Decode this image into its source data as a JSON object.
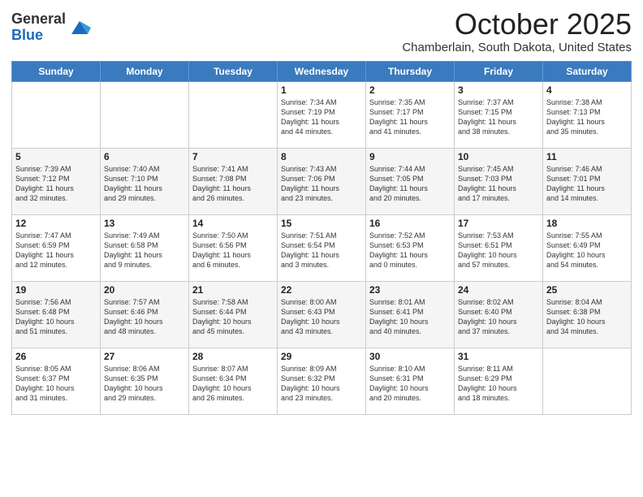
{
  "header": {
    "logo_general": "General",
    "logo_blue": "Blue",
    "month": "October 2025",
    "location": "Chamberlain, South Dakota, United States"
  },
  "weekdays": [
    "Sunday",
    "Monday",
    "Tuesday",
    "Wednesday",
    "Thursday",
    "Friday",
    "Saturday"
  ],
  "weeks": [
    [
      {
        "day": "",
        "info": ""
      },
      {
        "day": "",
        "info": ""
      },
      {
        "day": "",
        "info": ""
      },
      {
        "day": "1",
        "info": "Sunrise: 7:34 AM\nSunset: 7:19 PM\nDaylight: 11 hours\nand 44 minutes."
      },
      {
        "day": "2",
        "info": "Sunrise: 7:35 AM\nSunset: 7:17 PM\nDaylight: 11 hours\nand 41 minutes."
      },
      {
        "day": "3",
        "info": "Sunrise: 7:37 AM\nSunset: 7:15 PM\nDaylight: 11 hours\nand 38 minutes."
      },
      {
        "day": "4",
        "info": "Sunrise: 7:38 AM\nSunset: 7:13 PM\nDaylight: 11 hours\nand 35 minutes."
      }
    ],
    [
      {
        "day": "5",
        "info": "Sunrise: 7:39 AM\nSunset: 7:12 PM\nDaylight: 11 hours\nand 32 minutes."
      },
      {
        "day": "6",
        "info": "Sunrise: 7:40 AM\nSunset: 7:10 PM\nDaylight: 11 hours\nand 29 minutes."
      },
      {
        "day": "7",
        "info": "Sunrise: 7:41 AM\nSunset: 7:08 PM\nDaylight: 11 hours\nand 26 minutes."
      },
      {
        "day": "8",
        "info": "Sunrise: 7:43 AM\nSunset: 7:06 PM\nDaylight: 11 hours\nand 23 minutes."
      },
      {
        "day": "9",
        "info": "Sunrise: 7:44 AM\nSunset: 7:05 PM\nDaylight: 11 hours\nand 20 minutes."
      },
      {
        "day": "10",
        "info": "Sunrise: 7:45 AM\nSunset: 7:03 PM\nDaylight: 11 hours\nand 17 minutes."
      },
      {
        "day": "11",
        "info": "Sunrise: 7:46 AM\nSunset: 7:01 PM\nDaylight: 11 hours\nand 14 minutes."
      }
    ],
    [
      {
        "day": "12",
        "info": "Sunrise: 7:47 AM\nSunset: 6:59 PM\nDaylight: 11 hours\nand 12 minutes."
      },
      {
        "day": "13",
        "info": "Sunrise: 7:49 AM\nSunset: 6:58 PM\nDaylight: 11 hours\nand 9 minutes."
      },
      {
        "day": "14",
        "info": "Sunrise: 7:50 AM\nSunset: 6:56 PM\nDaylight: 11 hours\nand 6 minutes."
      },
      {
        "day": "15",
        "info": "Sunrise: 7:51 AM\nSunset: 6:54 PM\nDaylight: 11 hours\nand 3 minutes."
      },
      {
        "day": "16",
        "info": "Sunrise: 7:52 AM\nSunset: 6:53 PM\nDaylight: 11 hours\nand 0 minutes."
      },
      {
        "day": "17",
        "info": "Sunrise: 7:53 AM\nSunset: 6:51 PM\nDaylight: 10 hours\nand 57 minutes."
      },
      {
        "day": "18",
        "info": "Sunrise: 7:55 AM\nSunset: 6:49 PM\nDaylight: 10 hours\nand 54 minutes."
      }
    ],
    [
      {
        "day": "19",
        "info": "Sunrise: 7:56 AM\nSunset: 6:48 PM\nDaylight: 10 hours\nand 51 minutes."
      },
      {
        "day": "20",
        "info": "Sunrise: 7:57 AM\nSunset: 6:46 PM\nDaylight: 10 hours\nand 48 minutes."
      },
      {
        "day": "21",
        "info": "Sunrise: 7:58 AM\nSunset: 6:44 PM\nDaylight: 10 hours\nand 45 minutes."
      },
      {
        "day": "22",
        "info": "Sunrise: 8:00 AM\nSunset: 6:43 PM\nDaylight: 10 hours\nand 43 minutes."
      },
      {
        "day": "23",
        "info": "Sunrise: 8:01 AM\nSunset: 6:41 PM\nDaylight: 10 hours\nand 40 minutes."
      },
      {
        "day": "24",
        "info": "Sunrise: 8:02 AM\nSunset: 6:40 PM\nDaylight: 10 hours\nand 37 minutes."
      },
      {
        "day": "25",
        "info": "Sunrise: 8:04 AM\nSunset: 6:38 PM\nDaylight: 10 hours\nand 34 minutes."
      }
    ],
    [
      {
        "day": "26",
        "info": "Sunrise: 8:05 AM\nSunset: 6:37 PM\nDaylight: 10 hours\nand 31 minutes."
      },
      {
        "day": "27",
        "info": "Sunrise: 8:06 AM\nSunset: 6:35 PM\nDaylight: 10 hours\nand 29 minutes."
      },
      {
        "day": "28",
        "info": "Sunrise: 8:07 AM\nSunset: 6:34 PM\nDaylight: 10 hours\nand 26 minutes."
      },
      {
        "day": "29",
        "info": "Sunrise: 8:09 AM\nSunset: 6:32 PM\nDaylight: 10 hours\nand 23 minutes."
      },
      {
        "day": "30",
        "info": "Sunrise: 8:10 AM\nSunset: 6:31 PM\nDaylight: 10 hours\nand 20 minutes."
      },
      {
        "day": "31",
        "info": "Sunrise: 8:11 AM\nSunset: 6:29 PM\nDaylight: 10 hours\nand 18 minutes."
      },
      {
        "day": "",
        "info": ""
      }
    ]
  ]
}
